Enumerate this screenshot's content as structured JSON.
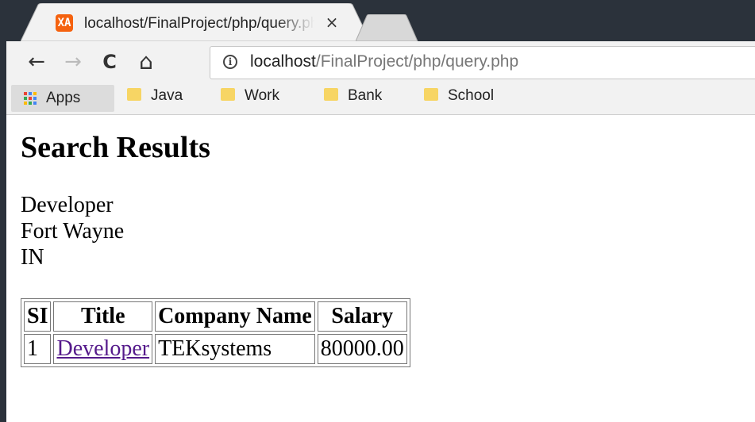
{
  "tab": {
    "title": "localhost/FinalProject/php/query.php",
    "favicon_label": "XA",
    "close_glyph": "×",
    "favicon_color": "#f5620f"
  },
  "toolbar": {
    "back_icon": "arrow-left-icon",
    "forward_icon": "arrow-right-icon",
    "reload_icon": "reload-icon",
    "home_icon": "home-icon",
    "back_glyph": "←",
    "forward_glyph": "→",
    "reload_glyph": "C",
    "home_glyph": "⌂",
    "info_glyph": "i",
    "url_host": "localhost",
    "url_path": "/FinalProject/php/query.php"
  },
  "bookmarks": {
    "apps_label": "Apps",
    "items": [
      {
        "label": "Java"
      },
      {
        "label": "Work"
      },
      {
        "label": "Bank"
      },
      {
        "label": "School"
      }
    ],
    "folder_color": "#f7d564"
  },
  "page": {
    "heading": "Search Results",
    "query": {
      "keyword": "Developer",
      "city": "Fort Wayne",
      "state": "IN"
    },
    "table": {
      "headers": [
        "SI",
        "Title",
        "Company Name",
        "Salary"
      ],
      "rows": [
        {
          "si": "1",
          "title": "Developer",
          "company": "TEKsystems",
          "salary": "80000.00"
        }
      ]
    },
    "link_color": "#551a8b"
  }
}
